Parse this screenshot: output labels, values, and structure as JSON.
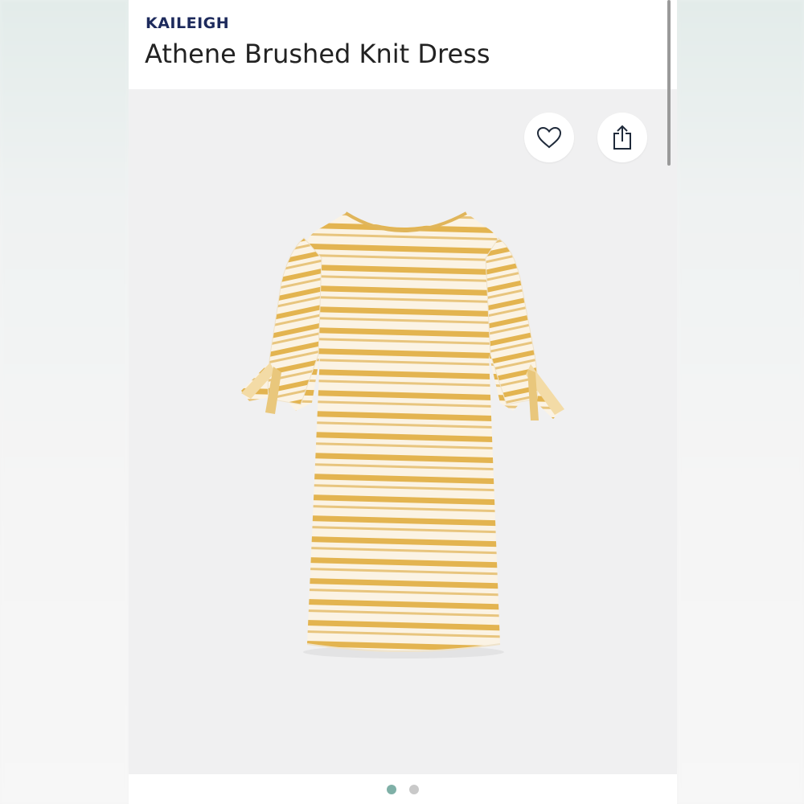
{
  "product": {
    "brand": "KAILEIGH",
    "name": "Athene Brushed Knit Dress"
  },
  "actions": {
    "favorite_icon": "heart-outline",
    "share_icon": "share-upload"
  },
  "carousel": {
    "total_images": 2,
    "active_index": 0
  },
  "colors": {
    "brand_text": "#1d2a5c",
    "stripe_mustard": "#e3b450",
    "dress_base": "#fbf3e4",
    "dot_active": "#7fb0a7",
    "dot_inactive": "#c9c9c9"
  }
}
